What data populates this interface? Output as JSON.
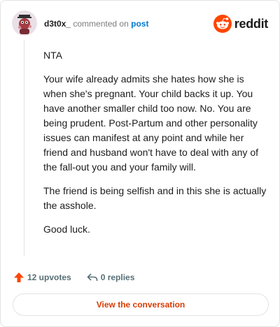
{
  "header": {
    "username": "d3t0x_",
    "commented_text": "commented on",
    "post_link": "post",
    "brand": "reddit"
  },
  "comment": {
    "paragraphs": [
      "NTA",
      "Your wife already admits she hates how she is when she's pregnant. Your child backs it up. You have another smaller child too now. No. You are being prudent. Post-Partum and other personality issues can manifest at any point and while her friend and husband won't have to deal with any of the fall-out you and your family will.",
      "The friend is being selfish and in this she is actually the asshole.",
      "Good luck."
    ]
  },
  "actions": {
    "upvotes": "12 upvotes",
    "replies": "0 replies"
  },
  "view_button": "View the conversation",
  "colors": {
    "accent": "#d93a00",
    "reddit_orange": "#ff4500",
    "link_blue": "#0079d3"
  }
}
